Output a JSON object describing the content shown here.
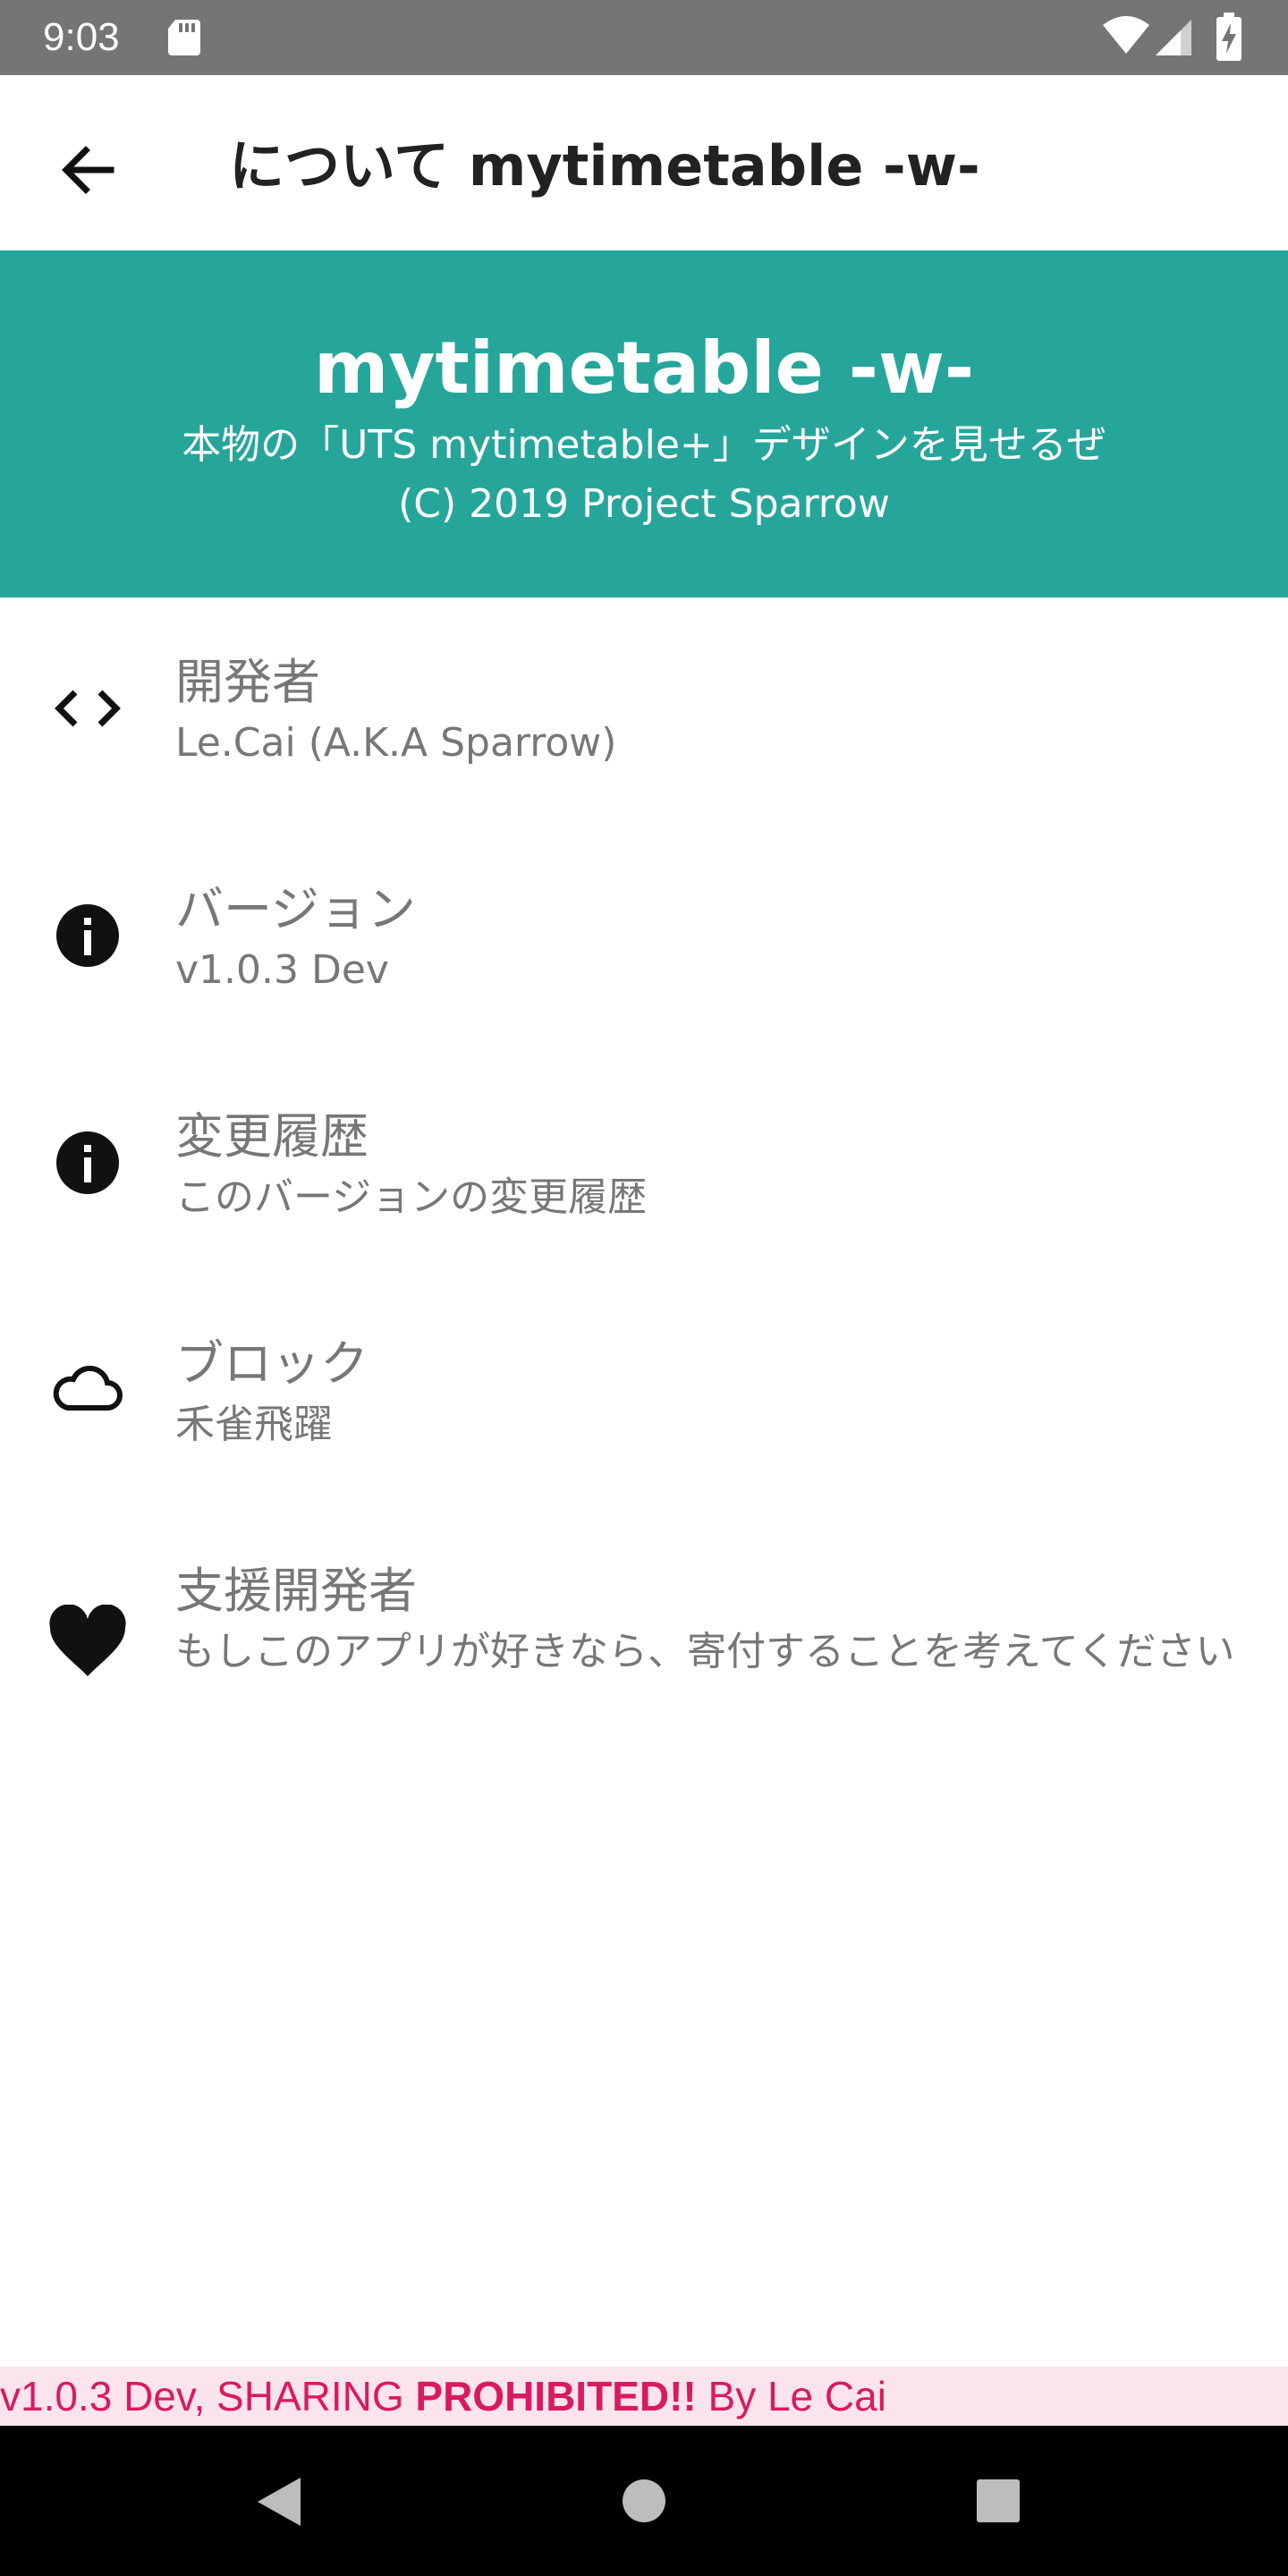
{
  "status_bar": {
    "time": "9:03",
    "icons": [
      "sd-card-icon",
      "wifi-icon",
      "signal-icon",
      "battery-charging-icon"
    ]
  },
  "app_bar": {
    "back_icon": "arrow-left-icon",
    "title": "について mytimetable -w-"
  },
  "banner": {
    "title": "mytimetable -w-",
    "subtitle": "本物の「UTS mytimetable+」デザインを見せるぜ",
    "copyright": "(C) 2019 Project Sparrow",
    "background_color": "#26a69a"
  },
  "items": [
    {
      "icon": "code-icon",
      "title": "開発者",
      "subtitle": "Le.Cai (A.K.A Sparrow)"
    },
    {
      "icon": "info-icon",
      "title": "バージョン",
      "subtitle": "v1.0.3 Dev"
    },
    {
      "icon": "info-icon",
      "title": "変更履歴",
      "subtitle": "このバージョンの変更履歴"
    },
    {
      "icon": "cloud-icon",
      "title": "ブロック",
      "subtitle": "禾雀飛躍"
    },
    {
      "icon": "heart-icon",
      "title": "支援開発者",
      "subtitle": "もしこのアプリが好きなら、寄付することを考えてください"
    }
  ],
  "footer": {
    "prefix": "v1.0.3 Dev, SHARING ",
    "emphasis": "PROHIBITED!!",
    "suffix": " By Le Cai",
    "text_color": "#d81b60",
    "background_color": "#fce4ec"
  },
  "nav_bar": {
    "buttons": [
      "nav-back-icon",
      "nav-home-icon",
      "nav-recent-icon"
    ]
  }
}
